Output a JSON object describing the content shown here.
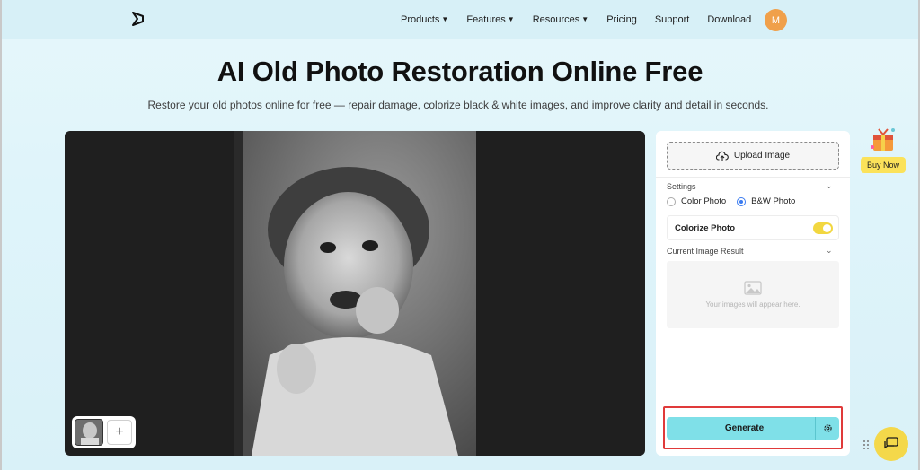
{
  "nav": {
    "items": [
      {
        "label": "Products",
        "has_caret": true
      },
      {
        "label": "Features",
        "has_caret": true
      },
      {
        "label": "Resources",
        "has_caret": true
      },
      {
        "label": "Pricing",
        "has_caret": false
      },
      {
        "label": "Support",
        "has_caret": false
      },
      {
        "label": "Download",
        "has_caret": false
      }
    ],
    "avatar_initial": "M",
    "avatar_color": "#f0a04a"
  },
  "hero": {
    "title": "AI Old Photo Restoration Online Free",
    "subtitle": "Restore your old photos online for free — repair damage, colorize black & white images, and improve clarity and detail in seconds."
  },
  "panel": {
    "upload_label": "Upload Image",
    "settings_label": "Settings",
    "photo_type_options": [
      "Color Photo",
      "B&W Photo"
    ],
    "photo_type_selected": "B&W Photo",
    "colorize_label": "Colorize Photo",
    "colorize_enabled": true,
    "result_label": "Current Image Result",
    "result_placeholder": "Your images will appear here.",
    "generate_label": "Generate"
  },
  "promo": {
    "buy_now_label": "Buy Now"
  },
  "colors": {
    "generate_bg": "#7fe0e8",
    "highlight_outline": "#e03a3a",
    "toggle_on": "#f2d740",
    "radio_selected": "#3a7bf0"
  },
  "icons": {
    "logo": "brand-logo-icon",
    "upload": "cloud-upload-icon",
    "settings_chevron": "chevron-down-icon",
    "result_chevron": "chevron-down-icon",
    "placeholder_image": "image-icon",
    "generate_settings": "gear-icon",
    "chat": "chat-icon",
    "gift": "gift-icon",
    "add": "plus-icon"
  }
}
